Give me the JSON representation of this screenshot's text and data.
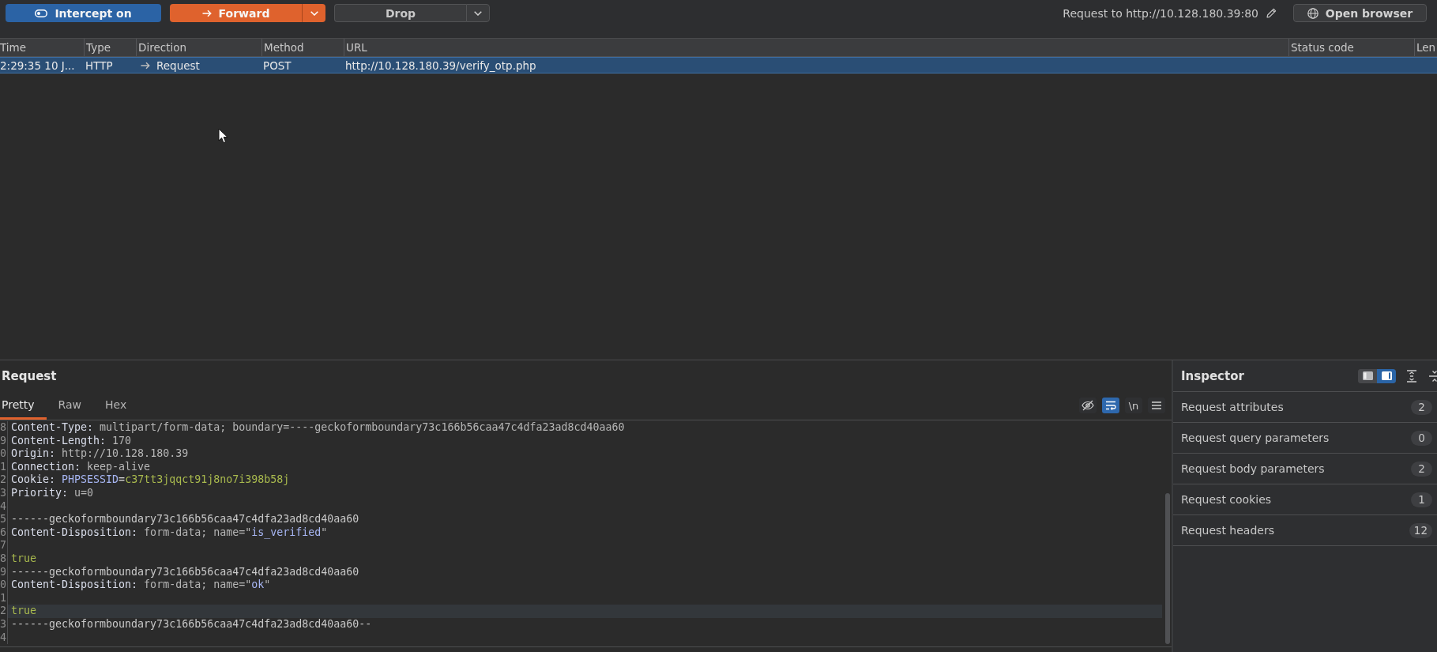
{
  "toolbar": {
    "intercept": {
      "label": "Intercept on",
      "on": true
    },
    "forward": {
      "label": "Forward"
    },
    "drop": {
      "label": "Drop"
    },
    "target": "Request to http://10.128.180.39:80",
    "open_browser": {
      "label": "Open browser"
    }
  },
  "table": {
    "columns": [
      "Time",
      "Type",
      "Direction",
      "Method",
      "URL",
      "Status code",
      "Len"
    ],
    "rows": [
      {
        "selected": true,
        "cells": [
          {
            "kind": "text",
            "text": "2:29:35 10 J..."
          },
          {
            "kind": "text",
            "text": "HTTP"
          },
          {
            "kind": "direction",
            "text": "Request"
          },
          {
            "kind": "text",
            "text": "POST"
          },
          {
            "kind": "text",
            "text": "http://10.128.180.39/verify_otp.php"
          }
        ]
      }
    ]
  },
  "request_editor": {
    "title": "Request",
    "tabs": [
      {
        "label": "Pretty",
        "selected": true
      },
      {
        "label": "Raw",
        "selected": false
      },
      {
        "label": "Hex",
        "selected": false
      }
    ],
    "tools": [
      {
        "kind": "hide",
        "on": false
      },
      {
        "kind": "wrap",
        "on": true
      },
      {
        "kind": "newline",
        "label": "\\n",
        "on": false
      },
      {
        "kind": "menu",
        "on": false
      }
    ],
    "lines": [
      {
        "number": "8",
        "current": false,
        "segments": [
          {
            "kind": "key",
            "text": "Content-Type:"
          },
          {
            "kind": "value",
            "text": " multipart/form-data; boundary=----geckoformboundary73c166b56caa47c4dfa23ad8cd40aa60"
          }
        ]
      },
      {
        "number": "9",
        "current": false,
        "segments": [
          {
            "kind": "key",
            "text": "Content-Length:"
          },
          {
            "kind": "value",
            "text": " 170"
          }
        ]
      },
      {
        "number": "0",
        "current": false,
        "segments": [
          {
            "kind": "key",
            "text": "Origin:"
          },
          {
            "kind": "value",
            "text": " http://10.128.180.39"
          }
        ]
      },
      {
        "number": "1",
        "current": false,
        "segments": [
          {
            "kind": "key",
            "text": "Connection:"
          },
          {
            "kind": "value",
            "text": " keep-alive"
          }
        ]
      },
      {
        "number": "2",
        "current": false,
        "segments": [
          {
            "kind": "key",
            "text": "Cookie: "
          },
          {
            "kind": "param",
            "text": "PHPSESSID"
          },
          {
            "kind": "punct",
            "text": "="
          },
          {
            "kind": "literal",
            "text": "c37tt3jqqct91j8no7i398b58j"
          }
        ]
      },
      {
        "number": "3",
        "current": false,
        "segments": [
          {
            "kind": "key",
            "text": "Priority:"
          },
          {
            "kind": "value",
            "text": " u=0"
          }
        ]
      },
      {
        "number": "4",
        "current": false
      },
      {
        "number": "5",
        "current": false,
        "segments": [
          {
            "kind": "text",
            "text": "------geckoformboundary73c166b56caa47c4dfa23ad8cd40aa60"
          }
        ]
      },
      {
        "number": "6",
        "current": false,
        "segments": [
          {
            "kind": "key",
            "text": "Content-Disposition:"
          },
          {
            "kind": "value",
            "text": " form-data; name=\""
          },
          {
            "kind": "param",
            "text": "is_verified"
          },
          {
            "kind": "value",
            "text": "\""
          }
        ]
      },
      {
        "number": "7",
        "current": false
      },
      {
        "number": "8",
        "current": false,
        "segments": [
          {
            "kind": "literal",
            "text": "true"
          }
        ]
      },
      {
        "number": "9",
        "current": false,
        "segments": [
          {
            "kind": "text",
            "text": "------geckoformboundary73c166b56caa47c4dfa23ad8cd40aa60"
          }
        ]
      },
      {
        "number": "0",
        "current": false,
        "segments": [
          {
            "kind": "key",
            "text": "Content-Disposition:"
          },
          {
            "kind": "value",
            "text": " form-data; name=\""
          },
          {
            "kind": "param",
            "text": "ok"
          },
          {
            "kind": "value",
            "text": "\""
          }
        ]
      },
      {
        "number": "1",
        "current": false
      },
      {
        "number": "2",
        "current": true,
        "segments": [
          {
            "kind": "literal",
            "text": "true"
          }
        ]
      },
      {
        "number": "3",
        "current": false,
        "segments": [
          {
            "kind": "text",
            "text": "------geckoformboundary73c166b56caa47c4dfa23ad8cd40aa60--"
          }
        ]
      },
      {
        "number": "4",
        "current": false
      }
    ]
  },
  "inspector": {
    "title": "Inspector",
    "layout": [
      {
        "kind": "left",
        "selected": false
      },
      {
        "kind": "right",
        "selected": true
      }
    ],
    "sections": [
      {
        "label": "Request attributes",
        "count": "2"
      },
      {
        "label": "Request query parameters",
        "count": "0"
      },
      {
        "label": "Request body parameters",
        "count": "2"
      },
      {
        "label": "Request cookies",
        "count": "1"
      },
      {
        "label": "Request headers",
        "count": "12"
      }
    ]
  }
}
